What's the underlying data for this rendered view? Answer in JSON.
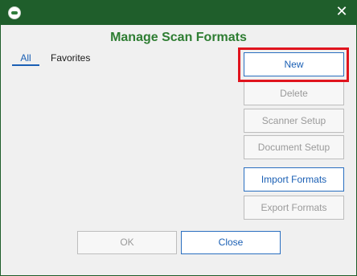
{
  "dialog": {
    "title": "Manage Scan Formats",
    "close_glyph": "✕",
    "app_icon": "app-logo-icon"
  },
  "tabs": [
    {
      "label": "All",
      "selected": true
    },
    {
      "label": "Favorites",
      "selected": false
    }
  ],
  "buttons": {
    "new": "New",
    "delete": "Delete",
    "scanner_setup": "Scanner Setup",
    "document_setup": "Document Setup",
    "import_formats": "Import Formats",
    "export_formats": "Export Formats",
    "ok": "OK",
    "close": "Close"
  },
  "colors": {
    "title_bar": "#1f5e2b",
    "heading": "#2e7d32",
    "accent": "#1a5fb4",
    "highlight": "#e0141e"
  }
}
